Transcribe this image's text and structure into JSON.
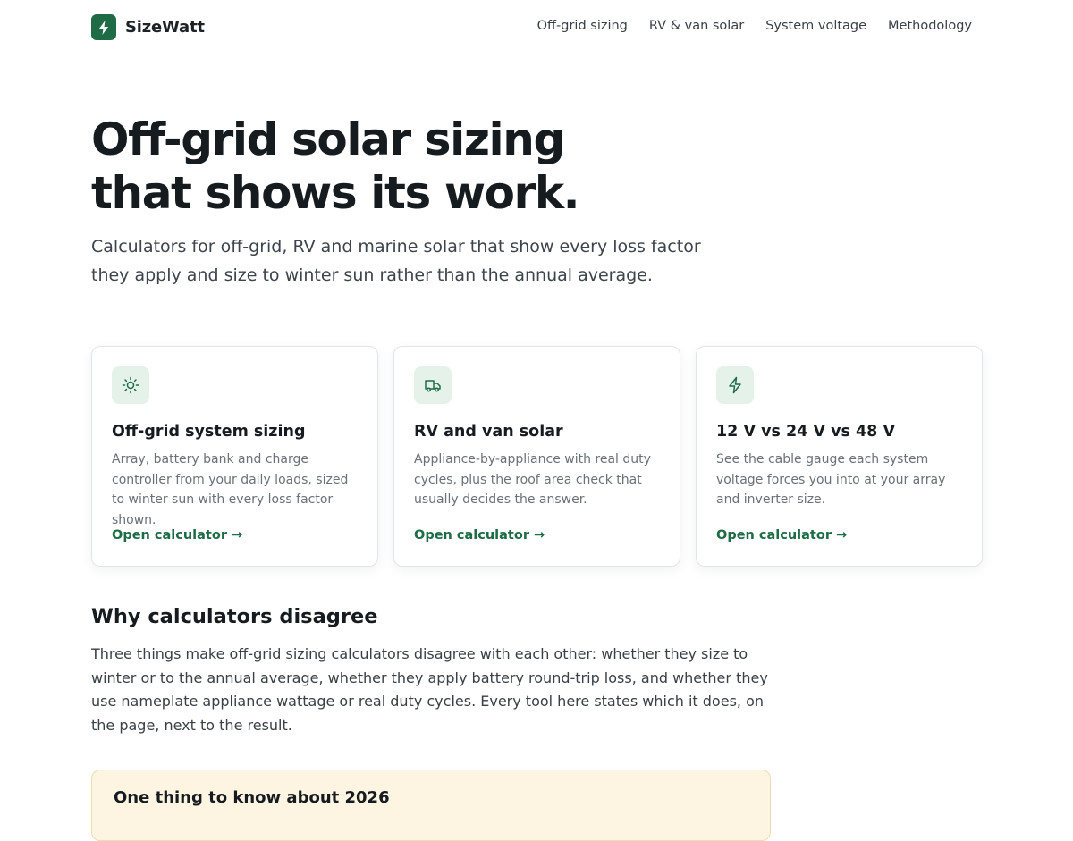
{
  "header": {
    "brand_name": "SizeWatt",
    "brand_icon": "bolt-icon",
    "nav": [
      "Off-grid sizing",
      "RV & van solar",
      "System voltage",
      "Methodology"
    ]
  },
  "hero": {
    "title_line1": "Off-grid solar sizing",
    "title_line2": "that shows its work.",
    "subtitle": "Calculators for off-grid, RV and marine solar that show every loss factor they apply and size to winter sun rather than the annual average."
  },
  "cards": [
    {
      "icon": "sun-icon",
      "title": "Off-grid system sizing",
      "description": "Array, battery bank and charge controller from your daily loads, sized to winter sun with every loss factor shown.",
      "link": "Open calculator →"
    },
    {
      "icon": "van-icon",
      "title": "RV and van solar",
      "description": "Appliance-by-appliance with real duty cycles, plus the roof area check that usually decides the answer.",
      "link": "Open calculator →"
    },
    {
      "icon": "bolt-icon",
      "title": "12 V vs 24 V vs 48 V",
      "description": "See the cable gauge each system voltage forces you into at your array and inverter size.",
      "link": "Open calculator →"
    }
  ],
  "section": {
    "title": "Why calculators disagree",
    "body": "Three things make off-grid sizing calculators disagree with each other: whether they size to winter or to the annual average, whether they apply battery round-trip loss, and whether they use nameplate appliance wattage or real duty cycles. Every tool here states which it does, on the page, next to the result."
  },
  "callout": {
    "title": "One thing to know about 2026"
  },
  "colors": {
    "accent": "#1f6b45",
    "icon_bg": "#e4f2ea",
    "callout_bg": "#fdf4e1"
  }
}
